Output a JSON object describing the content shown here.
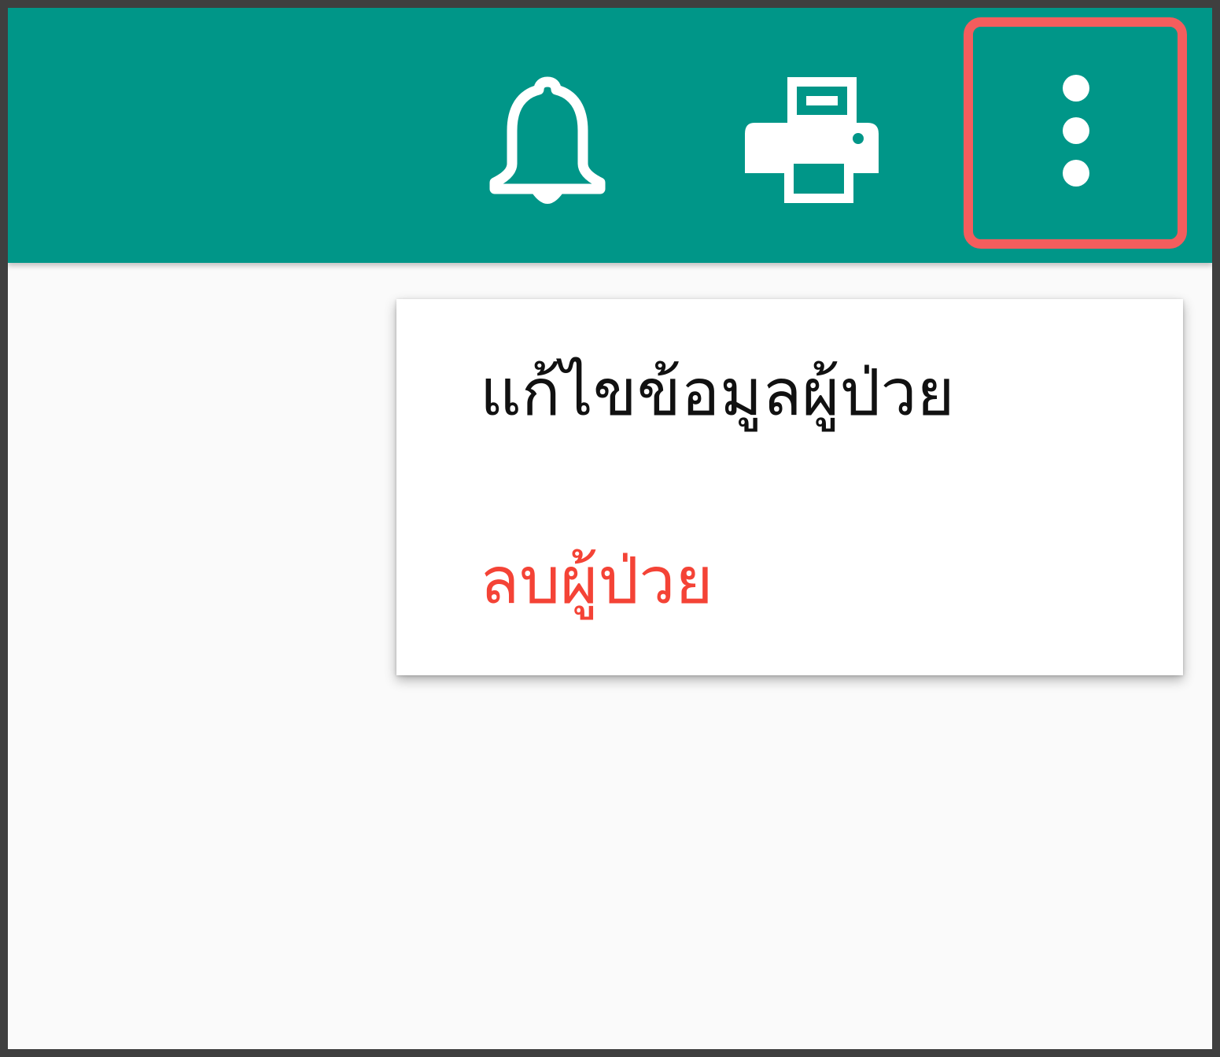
{
  "appbar": {
    "background_color": "#009688",
    "actions": [
      {
        "icon": "bell-icon"
      },
      {
        "icon": "printer-icon"
      },
      {
        "icon": "more-vert-icon",
        "highlighted": true
      }
    ]
  },
  "menu": {
    "items": [
      {
        "label": "แก้ไขข้อมูลผู้ป่วย",
        "color": "#111111"
      },
      {
        "label": "ลบผู้ป่วย",
        "color": "#f44336"
      }
    ]
  },
  "highlight_color": "#f45d5d"
}
